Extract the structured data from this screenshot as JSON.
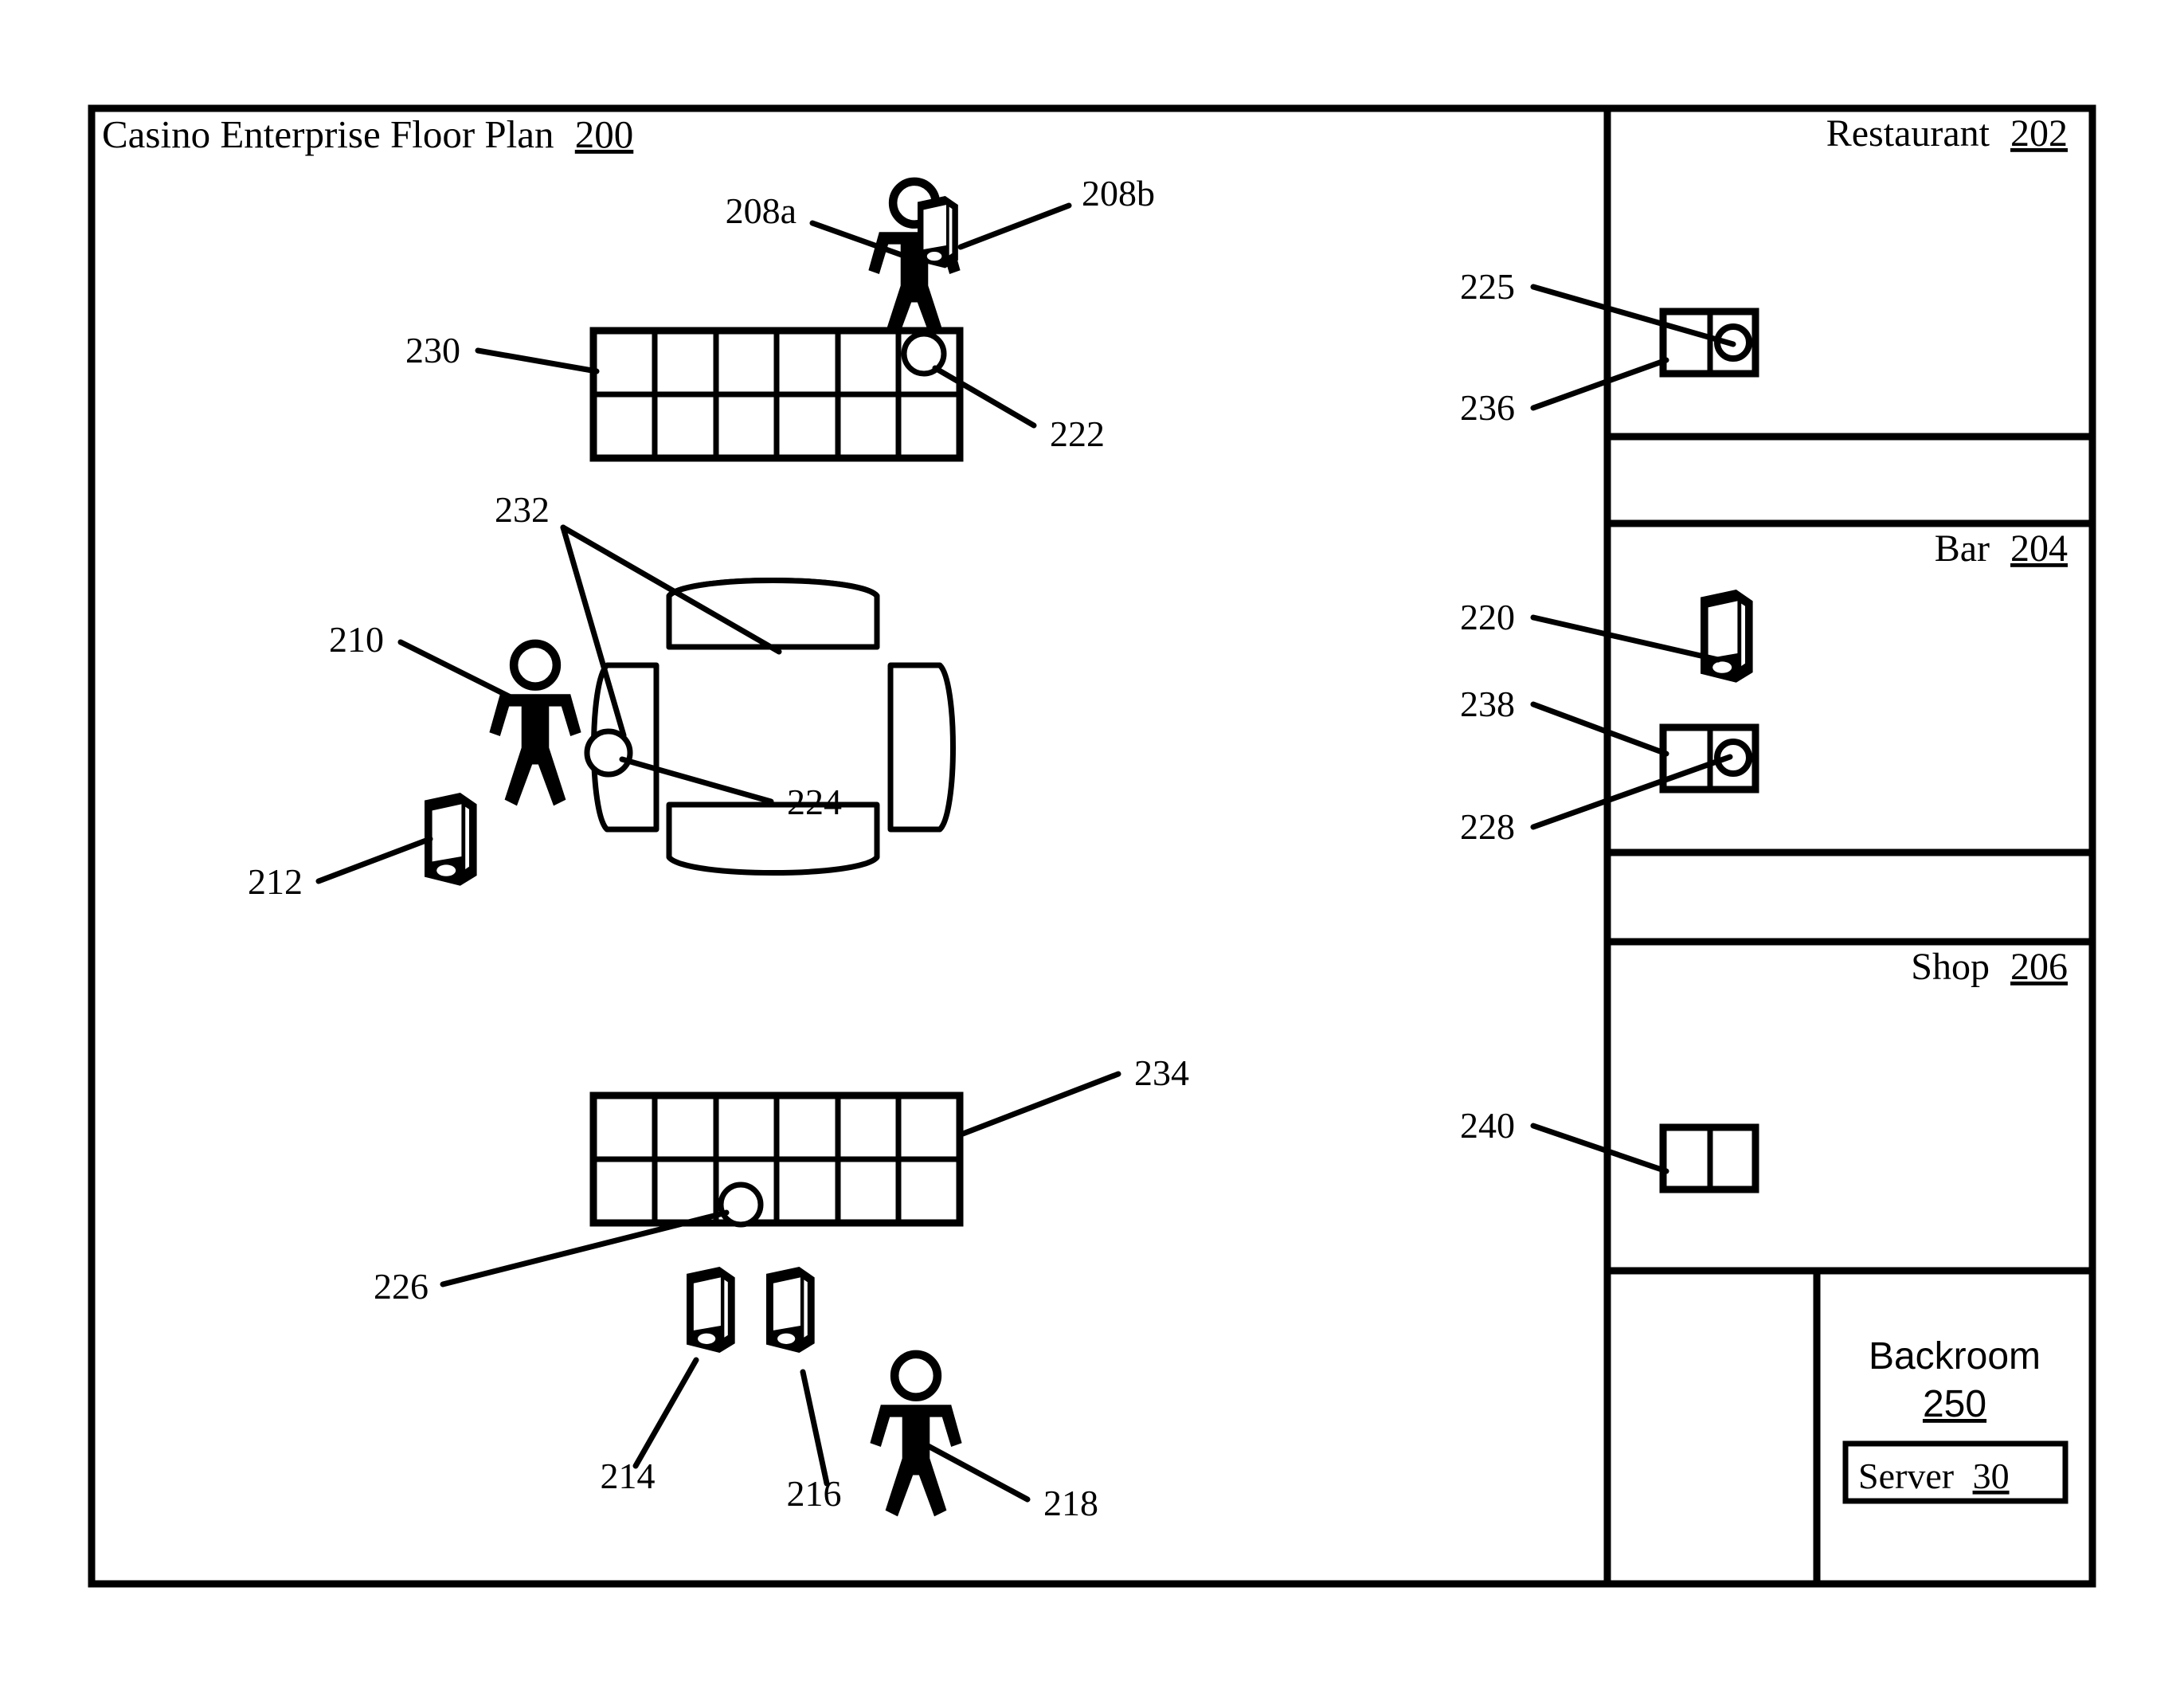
{
  "figure": {
    "type": "patent-floor-plan-diagram",
    "title_text": "Casino Enterprise Floor Plan",
    "title_ref": "200"
  },
  "rooms": [
    {
      "id": "restaurant",
      "name": "Restaurant",
      "ref": "202",
      "label_align": "right"
    },
    {
      "id": "bar",
      "name": "Bar",
      "ref": "204",
      "label_align": "right"
    },
    {
      "id": "shop",
      "name": "Shop",
      "ref": "206",
      "label_align": "right"
    },
    {
      "id": "backroom",
      "name": "Backroom",
      "ref": "250",
      "label_align": "center"
    }
  ],
  "backroom": {
    "server_box": {
      "name": "Server",
      "ref": "30"
    }
  },
  "reference_numerals": {
    "n200": "200",
    "n202": "202",
    "n204": "204",
    "n206": "206",
    "n208a": "208a",
    "n208b": "208b",
    "n210": "210",
    "n212": "212",
    "n214": "214",
    "n216": "216",
    "n218": "218",
    "n220": "220",
    "n222": "222",
    "n224": "224",
    "n225": "225",
    "n226": "226",
    "n228": "228",
    "n230": "230",
    "n232": "232",
    "n234": "234",
    "n236": "236",
    "n238": "238",
    "n240": "240",
    "n250": "250",
    "n30": "30"
  },
  "elements": [
    {
      "ref": "208a",
      "kind": "person",
      "description": "person holding mobile device on casino floor"
    },
    {
      "ref": "208b",
      "kind": "mobile-device",
      "description": "mobile device held by person 208a"
    },
    {
      "ref": "210",
      "kind": "person",
      "description": "person standing beside gaming table 232"
    },
    {
      "ref": "212",
      "kind": "mobile-device",
      "description": "mobile device near gaming table 232"
    },
    {
      "ref": "214",
      "kind": "mobile-device",
      "description": "mobile device at slot bank 234"
    },
    {
      "ref": "216",
      "kind": "mobile-device",
      "description": "mobile device at slot bank 234"
    },
    {
      "ref": "218",
      "kind": "person",
      "description": "person near slot bank 234"
    },
    {
      "ref": "220",
      "kind": "mobile-device",
      "description": "mobile device in Bar 204"
    },
    {
      "ref": "222",
      "kind": "sensor-marker",
      "description": "sensor on slot bank 230"
    },
    {
      "ref": "224",
      "kind": "sensor-marker",
      "description": "sensor on gaming table 232"
    },
    {
      "ref": "225",
      "kind": "sensor-marker",
      "description": "sensor on point-of-sale terminal 236"
    },
    {
      "ref": "226",
      "kind": "sensor-marker",
      "description": "sensor on slot bank 234"
    },
    {
      "ref": "228",
      "kind": "sensor-marker",
      "description": "sensor on point-of-sale terminal 238"
    },
    {
      "ref": "230",
      "kind": "slot-bank",
      "description": "bank of gaming machines, 6 by 2 grid"
    },
    {
      "ref": "232",
      "kind": "gaming-table",
      "description": "gaming table with seating positions"
    },
    {
      "ref": "234",
      "kind": "slot-bank",
      "description": "bank of gaming machines, 6 by 2 grid"
    },
    {
      "ref": "236",
      "kind": "pos-terminal",
      "description": "point-of-sale terminal in Restaurant 202"
    },
    {
      "ref": "238",
      "kind": "pos-terminal",
      "description": "point-of-sale terminal in Bar 204"
    },
    {
      "ref": "240",
      "kind": "pos-terminal",
      "description": "point-of-sale terminal in Shop 206"
    },
    {
      "ref": "250",
      "kind": "room",
      "description": "Backroom containing server"
    },
    {
      "ref": "30",
      "kind": "server",
      "description": "Server in Backroom 250"
    }
  ]
}
